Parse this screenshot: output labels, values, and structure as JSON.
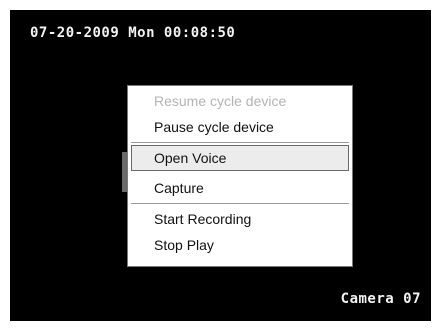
{
  "osd": {
    "datetime": "07-20-2009 Mon 00:08:50",
    "camera": "Camera 07"
  },
  "menu": {
    "resume_cycle": "Resume cycle device",
    "pause_cycle": "Pause cycle device",
    "open_voice": "Open Voice",
    "capture": "Capture",
    "start_recording": "Start Recording",
    "stop_play": "Stop Play"
  },
  "colors": {
    "screen_background": "#000000",
    "osd_text": "#f2f2f2",
    "menu_background": "#ffffff",
    "disabled_text": "#b4b4b4",
    "selected_border": "#6a6a6a"
  }
}
